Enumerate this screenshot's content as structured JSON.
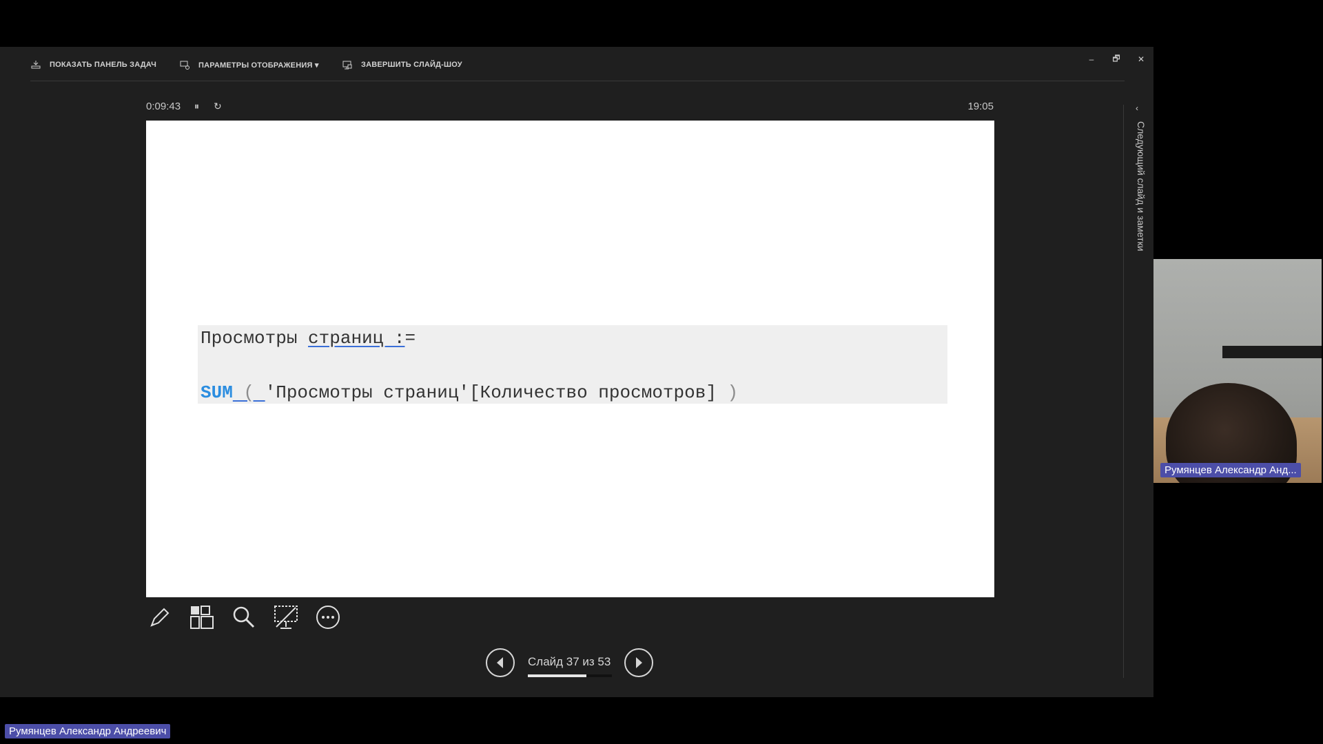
{
  "toolbar": {
    "show_taskbar": "ПОКАЗАТЬ ПАНЕЛЬ ЗАДАЧ",
    "display_settings": "ПАРАМЕТРЫ ОТОБРАЖЕНИЯ ▾",
    "end_show": "ЗАВЕРШИТЬ СЛАЙД-ШОУ"
  },
  "window_controls": {
    "minimize": "–",
    "restore": "🗗",
    "close": "✕"
  },
  "timer": {
    "elapsed": "0:09:43",
    "pause": "⏸",
    "reset": "↻",
    "clock": "19:05"
  },
  "slide": {
    "line1_a": "Просмотры ",
    "line1_b": "страниц :",
    "line1_c": "=",
    "line2_kw": "SUM",
    "line2_open": " ( ",
    "line2_body": "'Просмотры страниц'[Количество просмотров]",
    "line2_close": " )"
  },
  "nav": {
    "label": "Слайд 37 из 53",
    "progress": 0.698
  },
  "side_panel": {
    "toggle": "‹",
    "label": "Следующий слайд и заметки"
  },
  "webcam": {
    "name": "Румянцев Александр Анд..."
  },
  "bottom": {
    "name": "Румянцев Александр Андреевич"
  },
  "icons": [
    "pen-icon",
    "grid-icon",
    "magnifier-icon",
    "black-screen-icon",
    "more-icon"
  ],
  "colors": {
    "keyword": "#2b8de0",
    "name_tag": "#4c4ea8"
  }
}
